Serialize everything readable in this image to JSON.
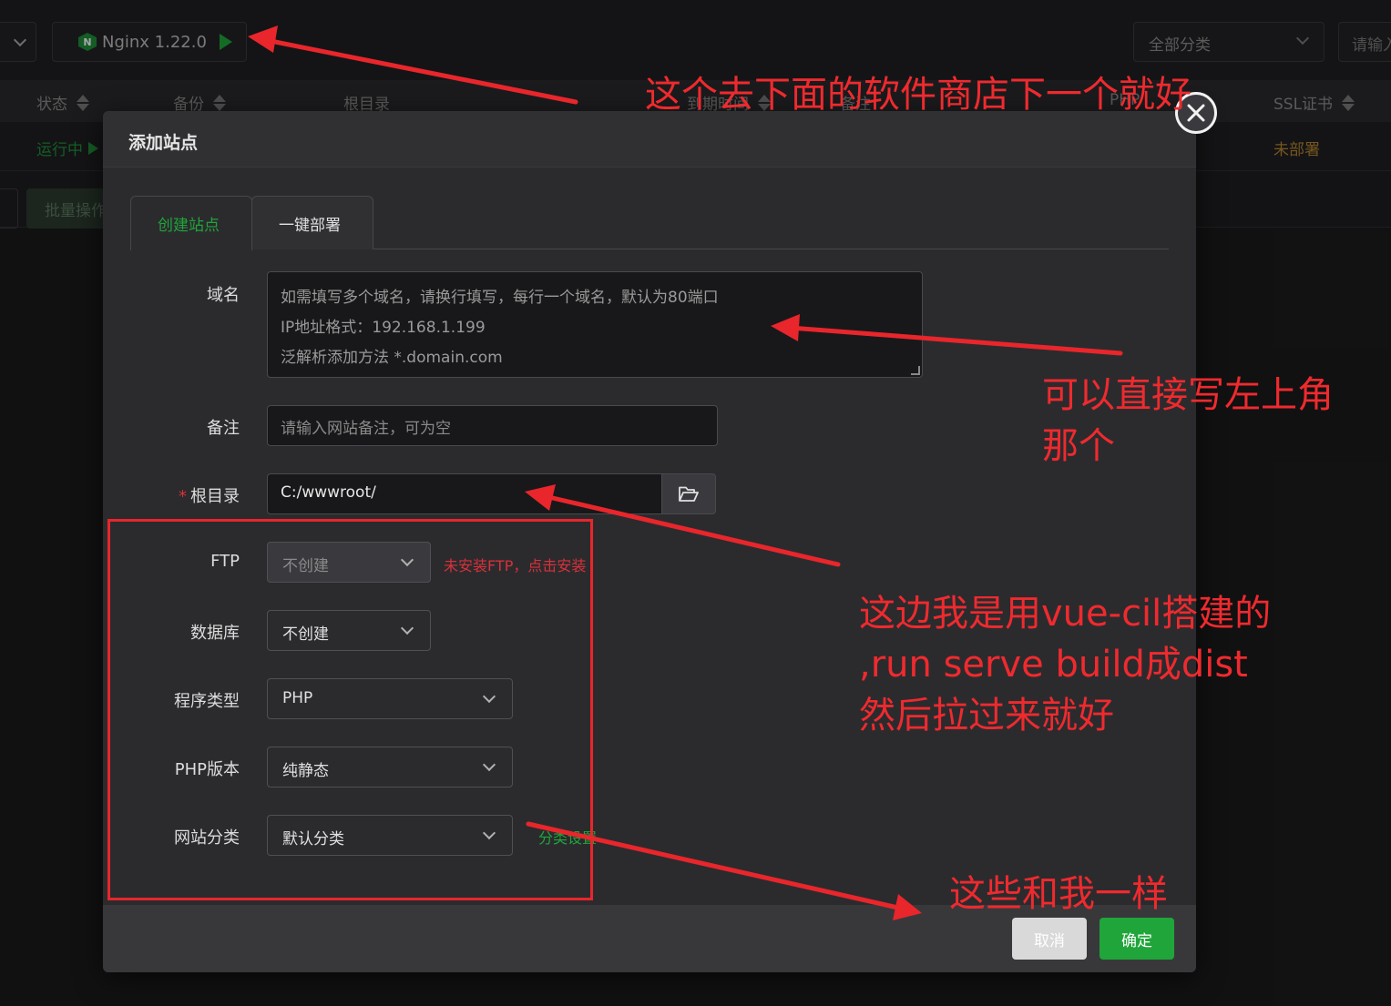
{
  "topbar": {
    "server_label": "Nginx 1.22.0",
    "category_select": "全部分类",
    "search_placeholder": "请输入"
  },
  "table": {
    "headers": [
      "状态",
      "备份",
      "根目录",
      "到期时间",
      "备注",
      "PHP",
      "SSL证书"
    ],
    "row_status": "运行中",
    "row_ssl": "未部署",
    "batch_button": "批量操作"
  },
  "modal": {
    "title": "添加站点",
    "tabs": [
      "创建站点",
      "一键部署"
    ],
    "fields": {
      "domain_label": "域名",
      "domain_placeholder_lines": [
        "如需填写多个域名，请换行填写，每行一个域名，默认为80端口",
        "IP地址格式：192.168.1.199",
        "泛解析添加方法 *.domain.com"
      ],
      "remark_label": "备注",
      "remark_placeholder": "请输入网站备注，可为空",
      "root_label": "根目录",
      "root_value": "C:/wwwroot/",
      "ftp_label": "FTP",
      "ftp_value": "不创建",
      "ftp_hint": "未安装FTP，点击安装",
      "db_label": "数据库",
      "db_value": "不创建",
      "program_label": "程序类型",
      "program_value": "PHP",
      "php_label": "PHP版本",
      "php_value": "纯静态",
      "category_label": "网站分类",
      "category_value": "默认分类",
      "category_link": "分类设置"
    },
    "buttons": {
      "cancel": "取消",
      "confirm": "确定"
    }
  },
  "annotations": {
    "top": "这个去下面的软件商店下一个就好",
    "domain": [
      "可以直接写左上角",
      "那个"
    ],
    "root": [
      "这边我是用vue-cil搭建的",
      ",run serve build成dist",
      "然后拉过来就好"
    ],
    "bottom": "这些和我一样"
  },
  "colors": {
    "accent_green": "#20a53a",
    "annotation_red": "#ef2a2e",
    "warning_orange": "#b5842f"
  }
}
